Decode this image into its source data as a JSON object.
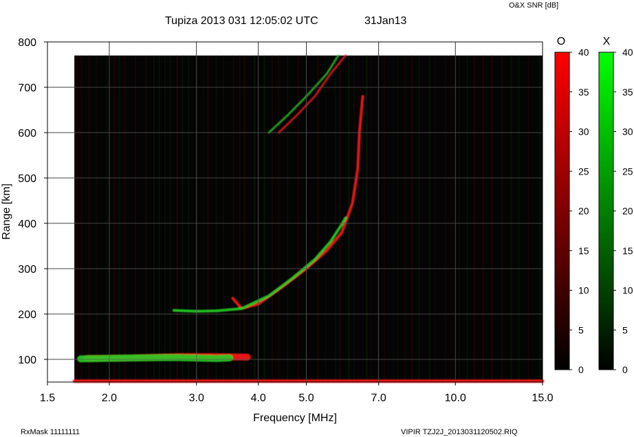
{
  "chart_data": {
    "type": "heatmap",
    "title": "Tupiza 2013 031 12:05:02 UTC",
    "date_label": "31Jan13",
    "xlabel": "Frequency [MHz]",
    "ylabel": "Range [km]",
    "x_scale": "log",
    "xlim": [
      1.5,
      15.0
    ],
    "ylim": [
      50,
      800
    ],
    "x_ticks": [
      "1.5",
      "2.0",
      "3.0",
      "4.0",
      "5.0",
      "7.0",
      "10.0",
      "15.0"
    ],
    "x_tick_values": [
      1.5,
      2.0,
      3.0,
      4.0,
      5.0,
      7.0,
      10.0,
      15.0
    ],
    "y_ticks": [
      "100",
      "200",
      "300",
      "400",
      "500",
      "600",
      "700",
      "800"
    ],
    "y_tick_values": [
      100,
      200,
      300,
      400,
      500,
      600,
      700,
      800
    ],
    "grid": true,
    "data_freq_range_mhz": [
      1.7,
      15.0
    ],
    "data_range_top_km": 770,
    "colorbar": {
      "title": "O&X SNR [dB]",
      "range": [
        0,
        40
      ],
      "ticks": [
        "40",
        "35",
        "30",
        "25",
        "20",
        "15",
        "10",
        "5",
        "0"
      ],
      "channels": [
        {
          "name": "O",
          "color": "#ff0000"
        },
        {
          "name": "X",
          "color": "#00ff00"
        }
      ]
    },
    "traces": [
      {
        "mode": "O",
        "layer": "E",
        "points": [
          [
            1.8,
            102
          ],
          [
            2.2,
            103
          ],
          [
            2.8,
            106
          ],
          [
            3.2,
            106
          ],
          [
            3.8,
            105
          ]
        ]
      },
      {
        "mode": "X",
        "layer": "E",
        "points": [
          [
            1.75,
            101
          ],
          [
            2.2,
            103
          ],
          [
            2.7,
            104
          ],
          [
            3.3,
            102
          ],
          [
            3.5,
            103
          ]
        ]
      },
      {
        "mode": "O",
        "layer": "F",
        "points": [
          [
            3.55,
            235
          ],
          [
            3.7,
            212
          ],
          [
            4.0,
            222
          ],
          [
            4.5,
            262
          ],
          [
            5.0,
            300
          ],
          [
            5.5,
            340
          ],
          [
            5.9,
            380
          ],
          [
            6.2,
            445
          ],
          [
            6.35,
            520
          ],
          [
            6.4,
            600
          ],
          [
            6.5,
            680
          ]
        ]
      },
      {
        "mode": "X",
        "layer": "F",
        "points": [
          [
            2.7,
            208
          ],
          [
            3.0,
            206
          ],
          [
            3.3,
            207
          ],
          [
            3.7,
            212
          ],
          [
            4.2,
            240
          ],
          [
            4.7,
            280
          ],
          [
            5.2,
            320
          ],
          [
            5.6,
            360
          ],
          [
            5.9,
            398
          ],
          [
            6.0,
            412
          ]
        ]
      },
      {
        "mode": "X",
        "layer": "F-multihop",
        "points": [
          [
            4.2,
            600
          ],
          [
            4.6,
            640
          ],
          [
            5.0,
            680
          ],
          [
            5.5,
            730
          ],
          [
            5.8,
            770
          ]
        ]
      },
      {
        "mode": "O",
        "layer": "F-multihop",
        "points": [
          [
            4.4,
            600
          ],
          [
            4.8,
            640
          ],
          [
            5.2,
            680
          ],
          [
            5.6,
            730
          ],
          [
            6.0,
            770
          ]
        ]
      },
      {
        "mode": "O",
        "layer": "ground",
        "points": [
          [
            1.7,
            52
          ],
          [
            15.0,
            52
          ]
        ]
      }
    ]
  },
  "footer": {
    "rxmask": "RxMask 11111111",
    "file": "VIPIR  TZJ2J_2013031120502.RIQ"
  }
}
